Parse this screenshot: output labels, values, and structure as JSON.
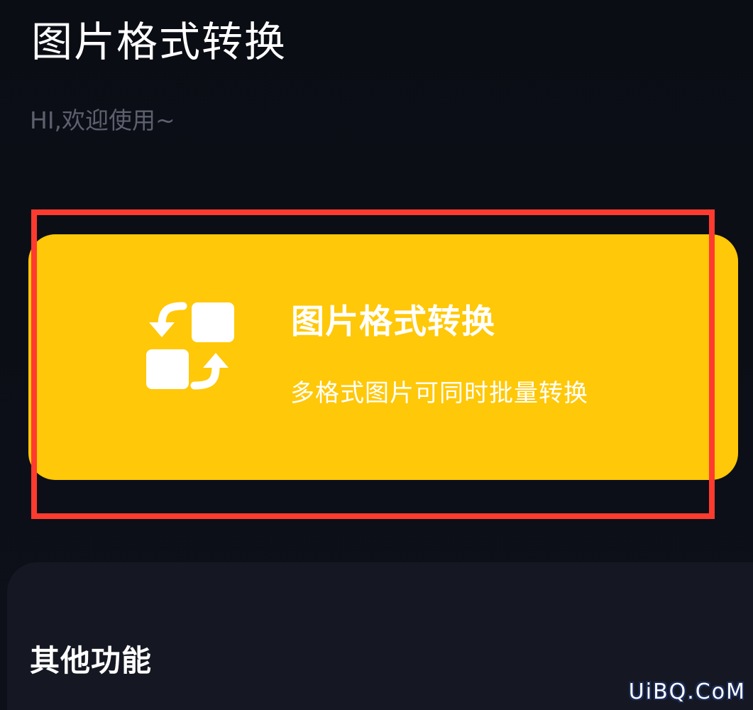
{
  "screen": {
    "title": "图片格式转换",
    "welcome": "HI,欢迎使用~"
  },
  "feature_card": {
    "title": "图片格式转换",
    "subtitle": "多格式图片可同时批量转换",
    "icon": "image-convert-icon"
  },
  "sections": {
    "other_features": "其他功能"
  },
  "watermark": {
    "text": "UiBQ.CoM"
  },
  "colors": {
    "background": "#0c0e16",
    "card": "#ffc808",
    "highlight_frame": "#ff3b2f",
    "panel": "#151822",
    "muted_text": "#5d616d"
  }
}
